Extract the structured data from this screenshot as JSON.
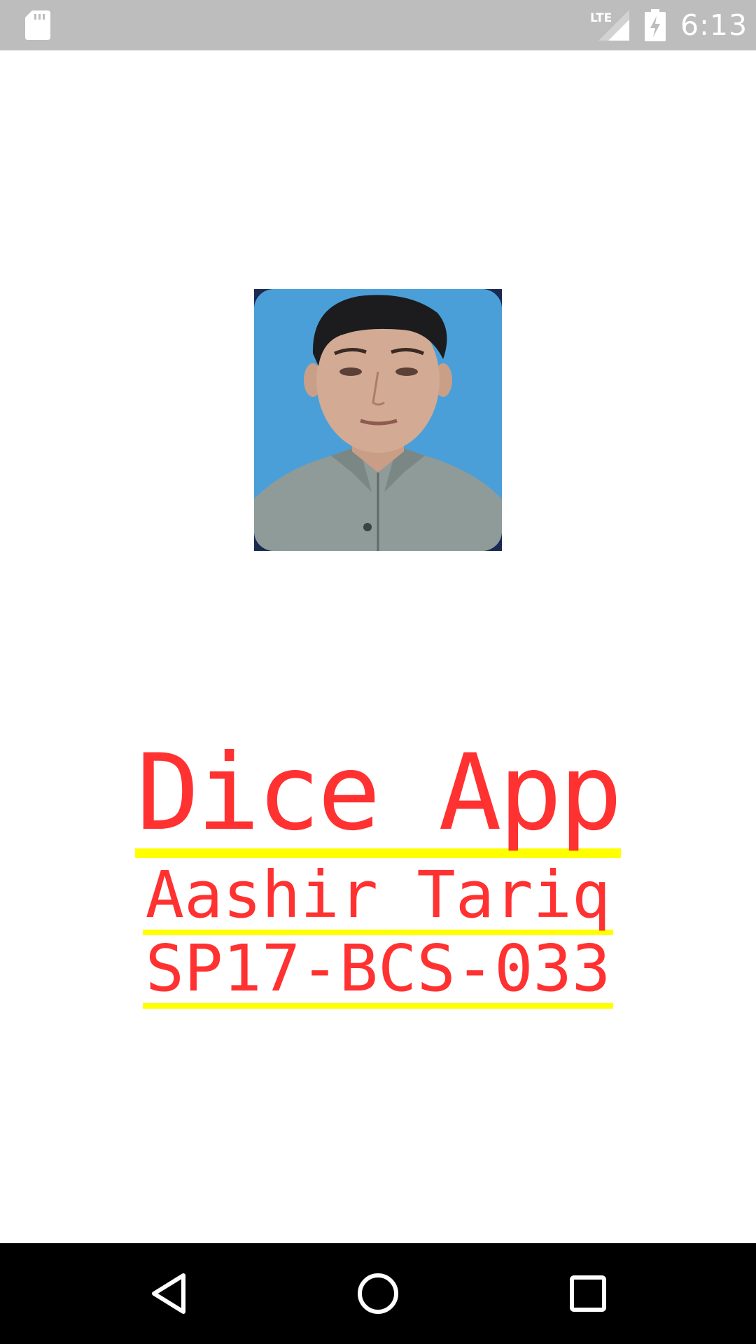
{
  "status_bar": {
    "time": "6:13",
    "network_label": "LTE",
    "icons": [
      "sd-card-icon",
      "lte-signal-icon",
      "battery-charging-icon"
    ]
  },
  "profile": {
    "photo_icon": "profile-photo"
  },
  "content": {
    "app_title": "Dice App",
    "author_name": "Aashir Tariq",
    "registration_number": "SP17-BCS-033"
  },
  "colors": {
    "title_text": "#ff3131",
    "underline": "#ffff00",
    "status_bar_bg": "#bdbdbd",
    "nav_bar_bg": "#000000"
  },
  "nav_bar": {
    "icons": [
      "back-icon",
      "home-icon",
      "recents-icon"
    ]
  }
}
